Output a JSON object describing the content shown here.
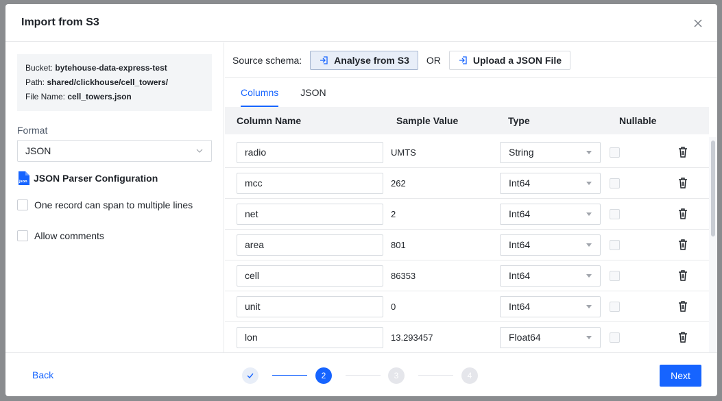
{
  "modal": {
    "title": "Import from S3"
  },
  "info": {
    "bucket_label": "Bucket:",
    "bucket_value": "bytehouse-data-express-test",
    "path_label": "Path:",
    "path_value": "shared/clickhouse/cell_towers/",
    "file_label": "File Name:",
    "file_value": "cell_towers.json"
  },
  "format": {
    "label": "Format",
    "value": "JSON"
  },
  "parser": {
    "title": "JSON Parser Configuration",
    "option1": "One record can span to multiple lines",
    "option2": "Allow comments"
  },
  "source": {
    "label": "Source schema:",
    "analyse_label": "Analyse from S3",
    "or_label": "OR",
    "upload_label": "Upload a JSON File"
  },
  "tabs": {
    "columns": "Columns",
    "json": "JSON"
  },
  "table": {
    "headers": {
      "name": "Column Name",
      "sample": "Sample Value",
      "type": "Type",
      "nullable": "Nullable"
    },
    "rows": [
      {
        "name": "radio",
        "sample": "UMTS",
        "type": "String"
      },
      {
        "name": "mcc",
        "sample": "262",
        "type": "Int64"
      },
      {
        "name": "net",
        "sample": "2",
        "type": "Int64"
      },
      {
        "name": "area",
        "sample": "801",
        "type": "Int64"
      },
      {
        "name": "cell",
        "sample": "86353",
        "type": "Int64"
      },
      {
        "name": "unit",
        "sample": "0",
        "type": "Int64"
      },
      {
        "name": "lon",
        "sample": "13.293457",
        "type": "Float64"
      }
    ]
  },
  "footer": {
    "back_label": "Back",
    "next_label": "Next",
    "steps": [
      "2",
      "3",
      "4"
    ]
  }
}
